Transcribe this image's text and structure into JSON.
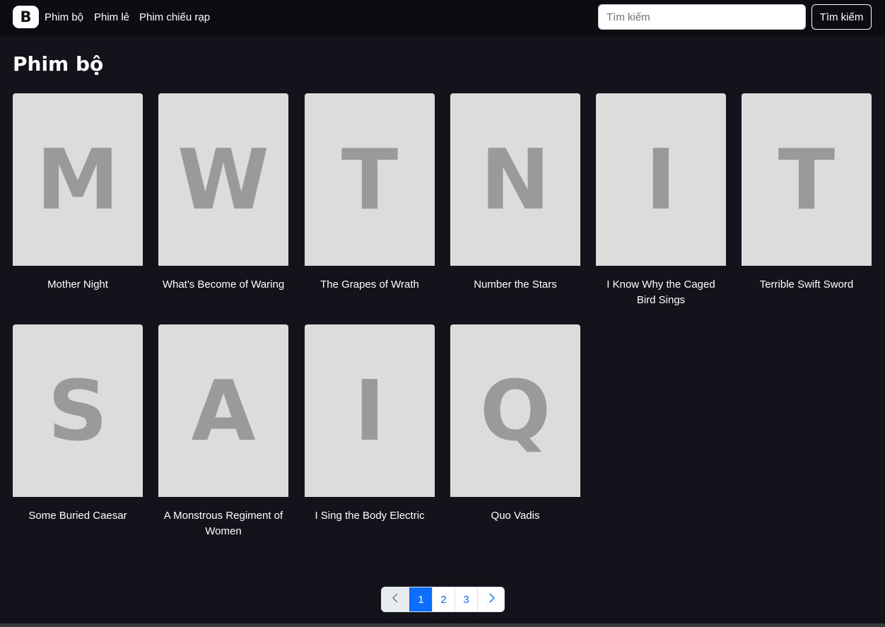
{
  "navbar": {
    "brand": "B",
    "links": [
      "Phim bộ",
      "Phim lẻ",
      "Phim chiếu rạp"
    ],
    "search_placeholder": "Tìm kiếm",
    "search_button": "Tìm kiếm"
  },
  "page_title": "Phim bộ",
  "movies": [
    {
      "letter": "M",
      "title": "Mother Night"
    },
    {
      "letter": "W",
      "title": "What's Become of Waring"
    },
    {
      "letter": "T",
      "title": "The Grapes of Wrath"
    },
    {
      "letter": "N",
      "title": "Number the Stars"
    },
    {
      "letter": "I",
      "title": "I Know Why the Caged Bird Sings"
    },
    {
      "letter": "T",
      "title": "Terrible Swift Sword"
    },
    {
      "letter": "S",
      "title": "Some Buried Caesar"
    },
    {
      "letter": "A",
      "title": "A Monstrous Regiment of Women"
    },
    {
      "letter": "I",
      "title": "I Sing the Body Electric"
    },
    {
      "letter": "Q",
      "title": "Quo Vadis"
    }
  ],
  "pagination": {
    "prev_icon": "chevron-left-icon",
    "pages": [
      "1",
      "2",
      "3"
    ],
    "active": "1",
    "next_icon": "chevron-right-icon"
  },
  "colors": {
    "background": "#13141b",
    "navbar": "#0c0d12",
    "poster": "#dcdcdc",
    "poster_letter": "#9a9a9a",
    "accent": "#0d6efd"
  }
}
